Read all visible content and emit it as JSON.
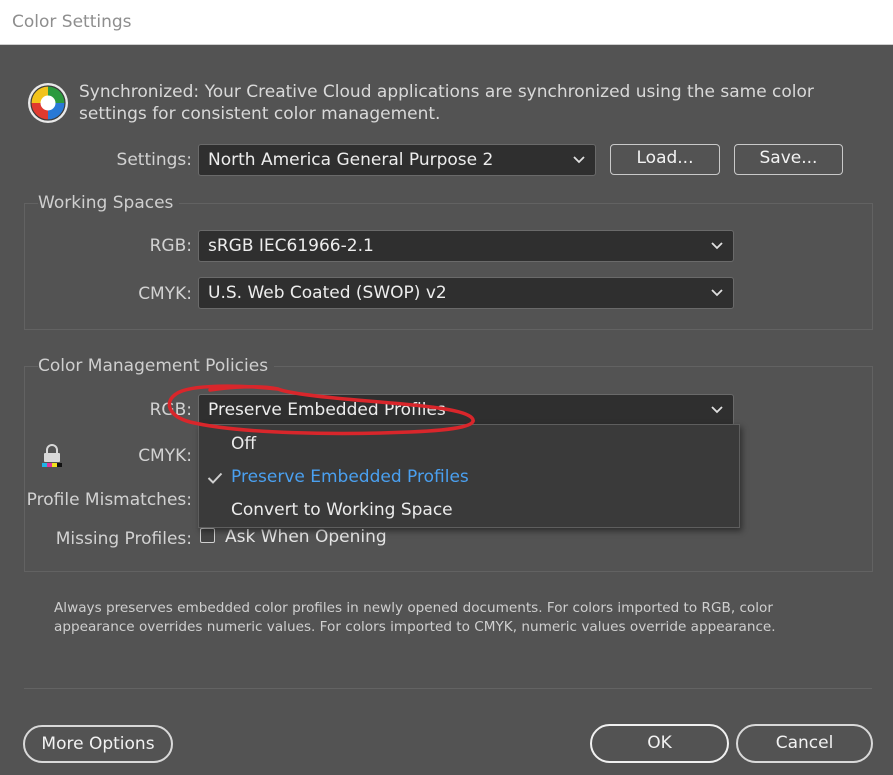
{
  "window": {
    "title": "Color Settings"
  },
  "sync": {
    "icon": "color-wheel-icon",
    "text": "Synchronized: Your Creative Cloud applications are synchronized using the same color settings for consistent color management."
  },
  "settings": {
    "label": "Settings:",
    "value": "North America General Purpose 2",
    "load_label": "Load...",
    "save_label": "Save..."
  },
  "working_spaces": {
    "title": "Working Spaces",
    "rgb_label": "RGB:",
    "rgb_value": "sRGB IEC61966-2.1",
    "cmyk_label": "CMYK:",
    "cmyk_value": "U.S. Web Coated (SWOP) v2"
  },
  "policies": {
    "title": "Color Management Policies",
    "rgb_label": "RGB:",
    "rgb_value": "Preserve Embedded Profiles",
    "cmyk_label": "CMYK:",
    "mismatch_label": "Profile Mismatches:",
    "missing_label": "Missing Profiles:",
    "missing_option": "Ask When Opening",
    "lock_icon": "lock-icon"
  },
  "dropdown": {
    "options": [
      "Off",
      "Preserve Embedded Profiles",
      "Convert to Working Space"
    ],
    "selected_index": 1
  },
  "description": "Always preserves embedded color profiles in newly opened documents. For colors imported to RGB, color appearance overrides numeric values. For colors imported to CMYK, numeric values override appearance.",
  "buttons": {
    "more_options": "More Options",
    "ok": "OK",
    "cancel": "Cancel"
  },
  "colors": {
    "accent_selected": "#4aa0f0",
    "annotation_red": "#d9262b",
    "dialog_bg": "#535353"
  }
}
